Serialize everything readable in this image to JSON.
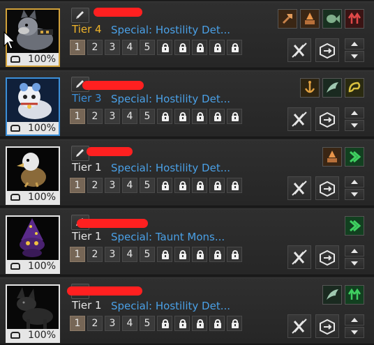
{
  "pets": [
    {
      "tier": "Tier 4",
      "tier_color": "#f0b429",
      "special": "Special: Hostility Det...",
      "pct": "100%",
      "frame_color": "#d2a23a",
      "abilities": [
        "axe-icon",
        "campfire-icon",
        "fish-icon",
        "arrows-up-icon"
      ],
      "slots": [
        "1",
        "2",
        "3",
        "4",
        "5"
      ]
    },
    {
      "tier": "Tier 3",
      "tier_color": "#3b8fd9",
      "special": "Special: Hostility Det...",
      "pct": "100%",
      "frame_color": "#3b8fd9",
      "abilities": [
        "anchor-icon",
        "wing-icon",
        "horn-icon"
      ],
      "slots": [
        "1",
        "2",
        "3",
        "4",
        "5"
      ]
    },
    {
      "tier": "Tier 1",
      "tier_color": "#e6e6e6",
      "special": "Special: Hostility Det...",
      "pct": "100%",
      "frame_color": "#e6e6e6",
      "abilities": [
        "campfire-icon",
        "speed-icon"
      ],
      "slots": [
        "1",
        "2",
        "3",
        "4",
        "5"
      ]
    },
    {
      "tier": "Tier 1",
      "tier_color": "#e6e6e6",
      "special": "Special: Taunt Mons...",
      "pct": "100%",
      "frame_color": "#e6e6e6",
      "abilities": [
        "speed-icon"
      ],
      "slots": [
        "1",
        "2",
        "3",
        "4",
        "5"
      ]
    },
    {
      "tier": "Tier 1",
      "tier_color": "#e6e6e6",
      "special": "Special: Hostility Det...",
      "pct": "100%",
      "frame_color": "#e6e6e6",
      "abilities": [
        "wing-icon",
        "arrows-up-icon"
      ],
      "slots": [
        "1",
        "2",
        "3",
        "4",
        "5"
      ]
    }
  ]
}
